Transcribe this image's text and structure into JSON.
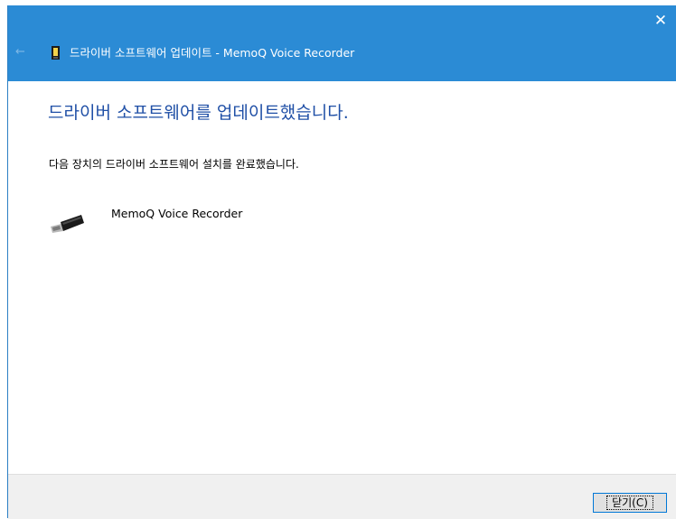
{
  "window": {
    "title": "드라이버 소프트웨어 업데이트 - MemoQ Voice Recorder",
    "close_glyph": "✕",
    "back_glyph": "←"
  },
  "main": {
    "heading": "드라이버 소프트웨어를 업데이트했습니다.",
    "description": "다음 장치의 드라이버 소프트웨어 설치를 완료했습니다.",
    "device_name": "MemoQ Voice Recorder",
    "device_icon": "usb-device-icon"
  },
  "footer": {
    "close_button_label": "닫기(C)"
  },
  "colors": {
    "titlebar": "#2b8bd5",
    "heading": "#1f4fa6",
    "footer": "#f0f0f0"
  }
}
